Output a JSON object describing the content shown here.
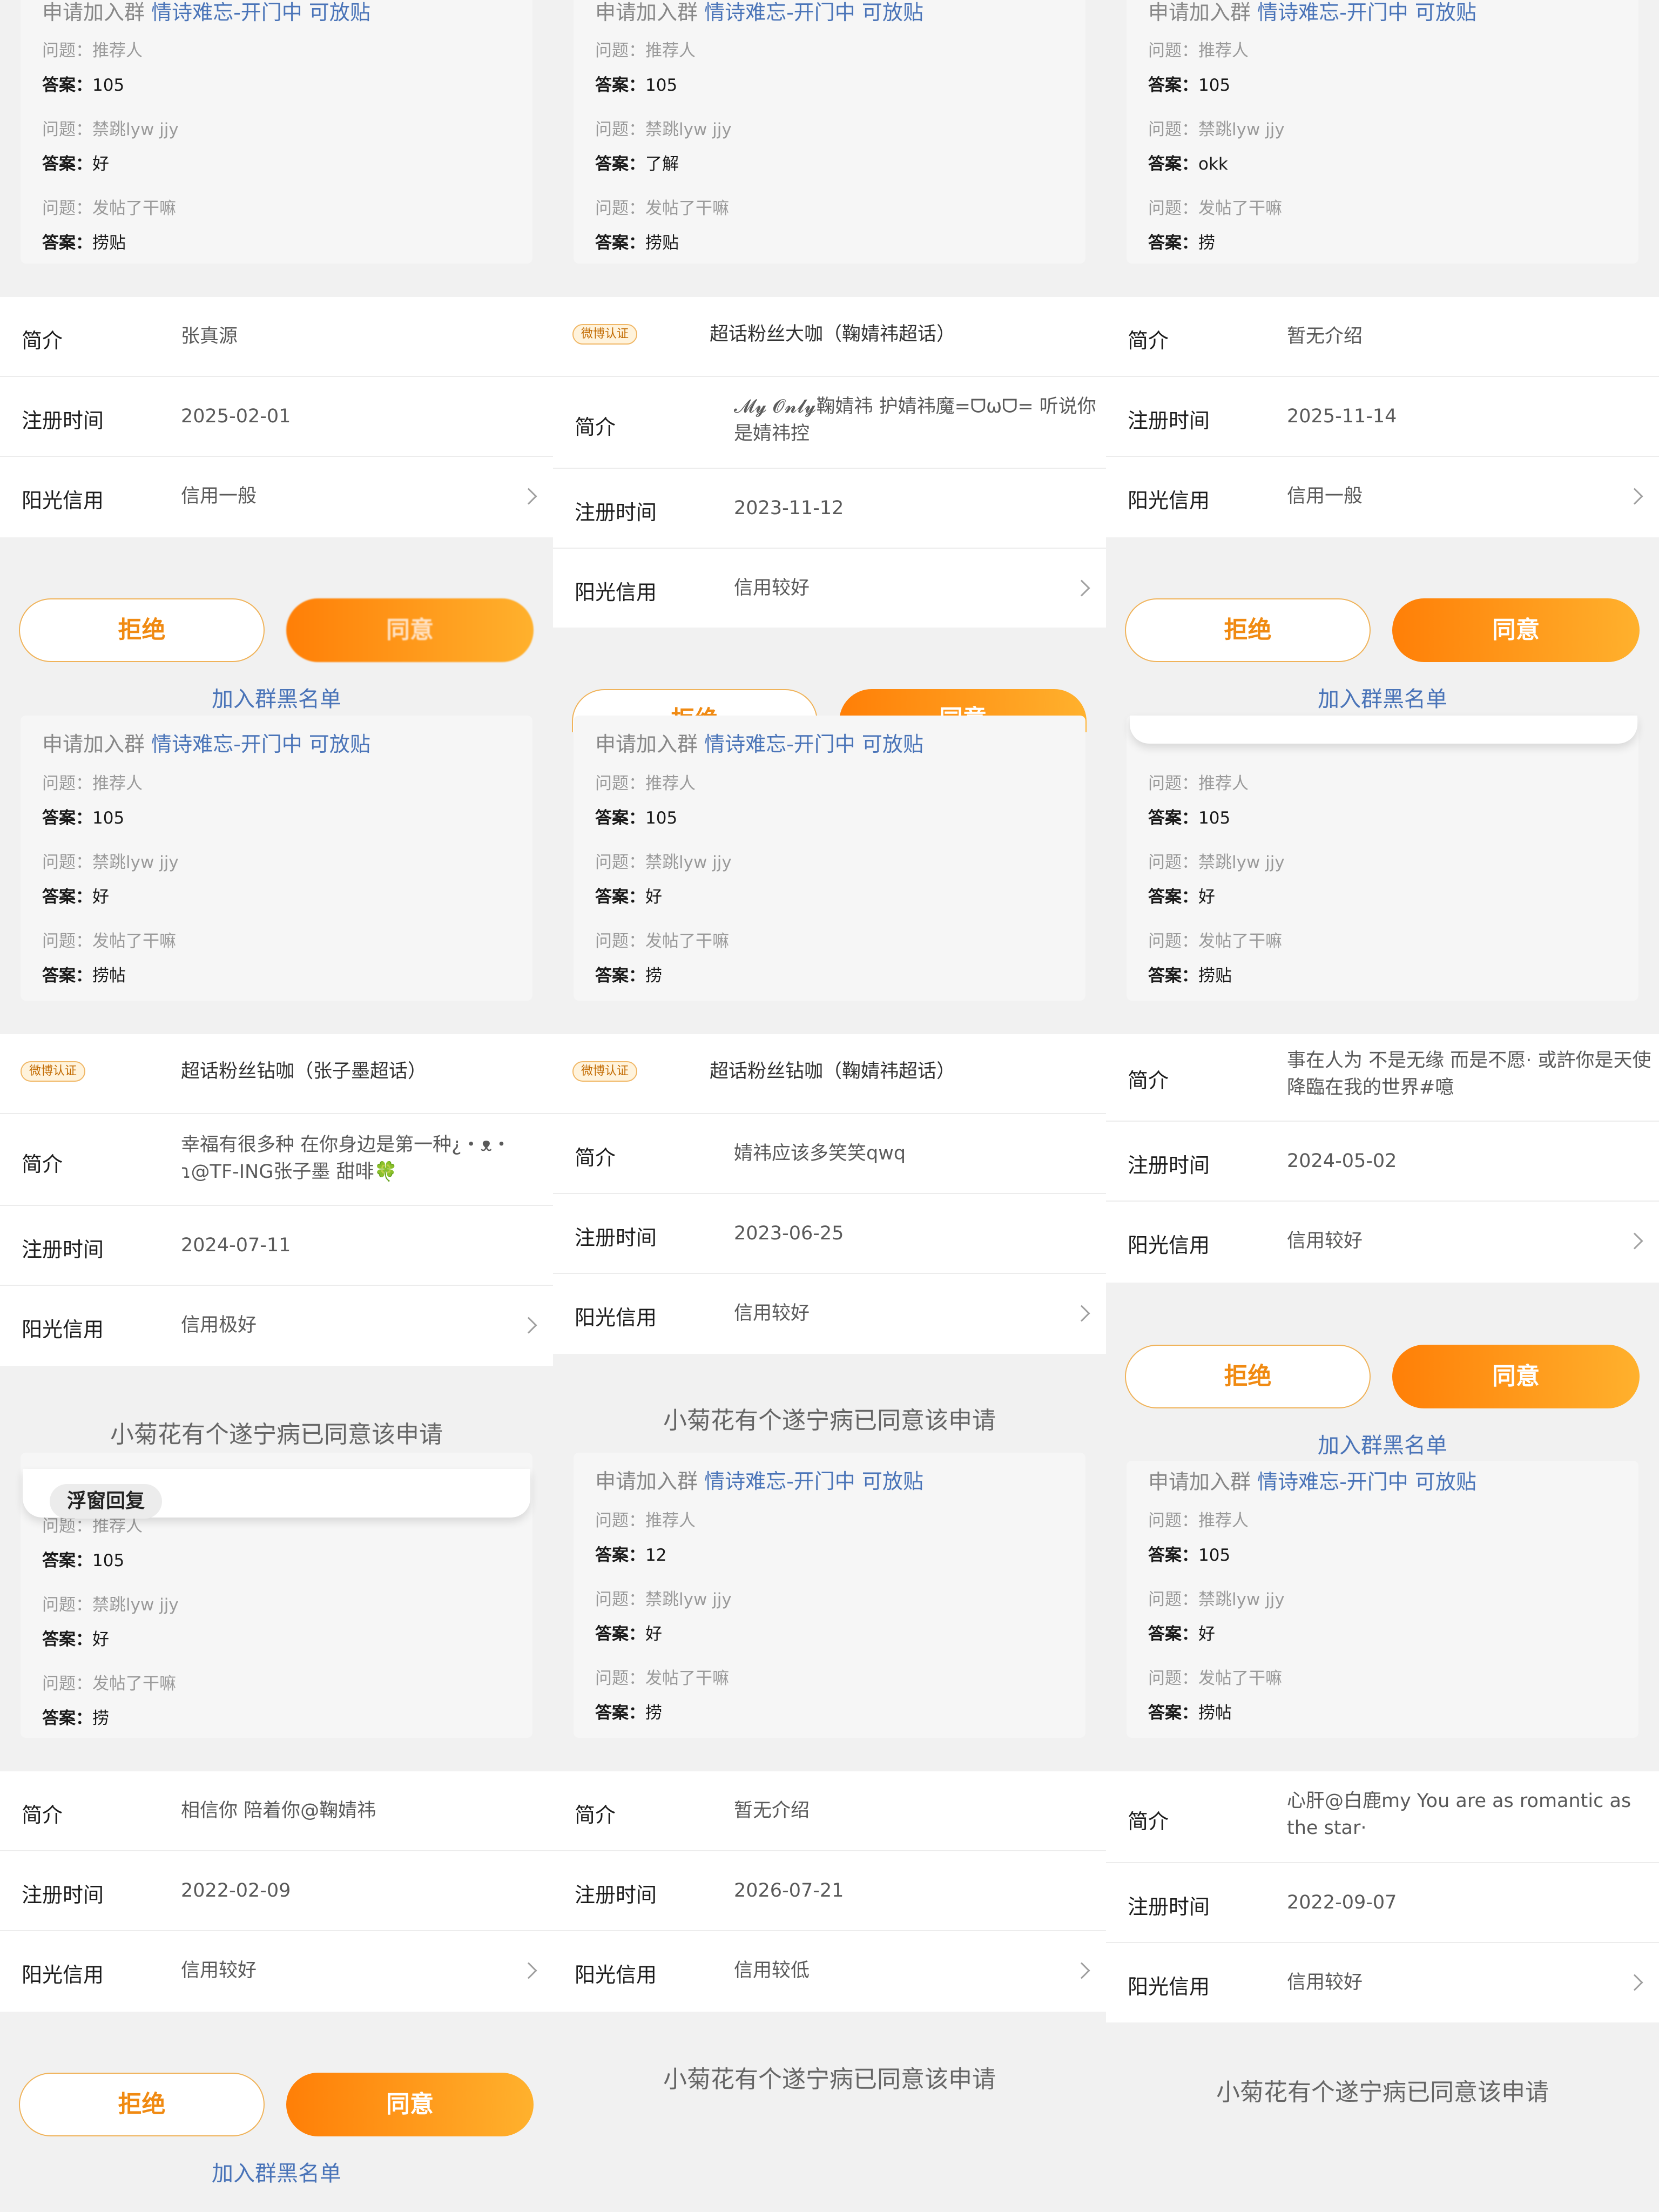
{
  "qa_header": {
    "prefix": "申请加入群 ",
    "group": "情诗难忘-开门中 可放贴"
  },
  "labels": {
    "question": "问题：",
    "answer": "答案：",
    "intro": "简介",
    "register": "注册时间",
    "credit": "阳光信用"
  },
  "questions": [
    "推荐人",
    "禁跳lyw jjy",
    "发帖了干嘛"
  ],
  "colors": {
    "accent": "#ff8a0e",
    "link": "#4a74b8"
  },
  "buttons": {
    "reject": "拒绝",
    "accept": "同意",
    "blacklist": "加入群黑名单"
  },
  "approved_msg": "小菊花有个遂宁病已同意该申请",
  "bubble_pill": "浮窗回复",
  "blurred_label": "同意",
  "verified_badge": "微博认证",
  "row0": {
    "qa": [
      [
        "105",
        "好",
        "捞贴"
      ],
      [
        "105",
        "了解",
        "捞贴"
      ],
      [
        "105",
        "okk",
        "捞"
      ]
    ],
    "info": [
      {
        "intro": "张真源",
        "date": "2025-02-01",
        "credit": "信用一般"
      },
      {
        "fan": "超话粉丝大咖（鞠婧祎超话）",
        "intro": "𝓜𝔂 𝓞𝓷𝓵𝔂鞠婧祎 护婧祎魔=ᗜωᗜ= 听说你是婧祎控",
        "date": "2023-11-12",
        "credit": "信用较好"
      },
      {
        "intro": "暂无介绍",
        "date": "2025-11-14",
        "credit": "信用一般"
      }
    ]
  },
  "row1": {
    "qa": [
      [
        "105",
        "好",
        "捞帖"
      ],
      [
        "105",
        "好",
        "捞"
      ],
      [
        "105",
        "好",
        "捞贴"
      ]
    ],
    "info": [
      {
        "fan": "超话粉丝钻咖（张子墨超话）",
        "intro": "幸福有很多种 在你身边是第一种¿・ᴥ・ɿ@TF-ING张子墨 甜啡🍀",
        "date": "2024-07-11",
        "credit": "信用极好"
      },
      {
        "fan": "超话粉丝钻咖（鞠婧祎超话）",
        "intro": "婧祎应该多笑笑qwq",
        "date": "2023-06-25",
        "credit": "信用较好"
      },
      {
        "intro": "事在人为 不是无缘 而是不愿· 或許你是天使降臨在我的世界#噫",
        "date": "2024-05-02",
        "credit": "信用较好"
      }
    ]
  },
  "row2": {
    "qa": [
      [
        "105",
        "好",
        "捞"
      ],
      [
        "12",
        "好",
        "捞"
      ],
      [
        "105",
        "好",
        "捞帖"
      ]
    ],
    "info": [
      {
        "intro": "相信你 陪着你@鞠婧祎",
        "date": "2022-02-09",
        "credit": "信用较好"
      },
      {
        "intro": "暂无介绍",
        "date": "2026-07-21",
        "credit": "信用较低"
      },
      {
        "intro": "心肝@白鹿my  You are as romantic as the star·",
        "date": "2022-09-07",
        "credit": "信用较好"
      }
    ]
  }
}
